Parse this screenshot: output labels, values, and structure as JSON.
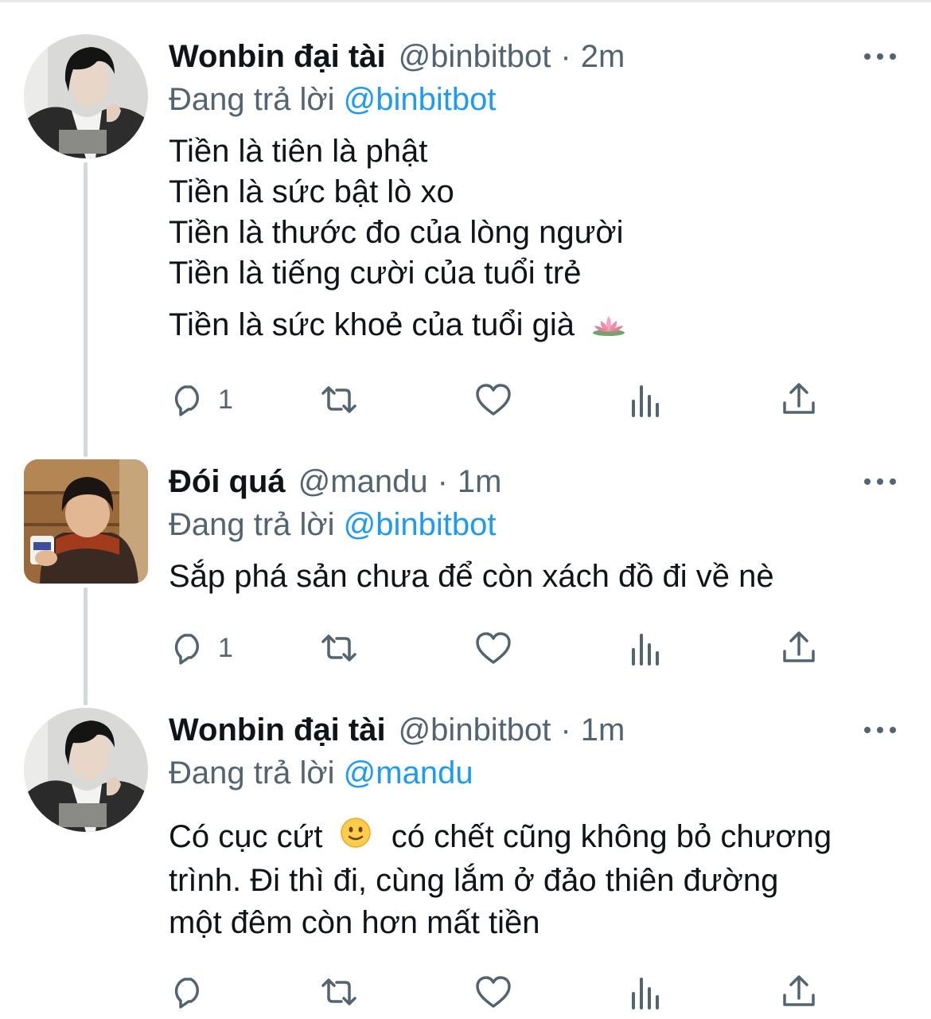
{
  "colors": {
    "accent": "#1d9bf0",
    "text": "#0f1419",
    "muted": "#536471",
    "thread_line": "#cfd9de"
  },
  "icons": {
    "reply": "reply-icon",
    "retweet": "retweet-icon",
    "like": "heart-icon",
    "views": "analytics-icon",
    "share": "share-icon",
    "more": "more-icon",
    "emoji_lotus": "lotus-emoji",
    "emoji_smile": "smile-emoji"
  },
  "reply_prefix": "Đang trả lời",
  "tweets": [
    {
      "name": "Wonbin đại tài",
      "handle": "@binbitbot",
      "separator": "·",
      "time": "2m",
      "reply_to": "@binbitbot",
      "lines": [
        "Tiền là tiên là phật",
        "Tiền là sức bật lò xo",
        "Tiền là thước đo của lòng người",
        "Tiền là tiếng cười của tuổi trẻ",
        "Tiền là sức khoẻ của tuổi già"
      ],
      "reply_count": "1"
    },
    {
      "name": "Đói quá",
      "handle": "@mandu",
      "separator": "·",
      "time": "1m",
      "reply_to": "@binbitbot",
      "lines": [
        "Sắp phá sản chưa để còn xách đồ đi về nè"
      ],
      "reply_count": "1"
    },
    {
      "name": "Wonbin đại tài",
      "handle": "@binbitbot",
      "separator": "·",
      "time": "1m",
      "reply_to": "@mandu",
      "line1_before": "Có cục cứt",
      "line1_after": " có chết cũng không bỏ chương",
      "lines": [
        "trình. Đi thì đi, cùng lắm ở đảo thiên đường",
        "một đêm còn hơn mất tiền"
      ],
      "reply_count": ""
    }
  ]
}
